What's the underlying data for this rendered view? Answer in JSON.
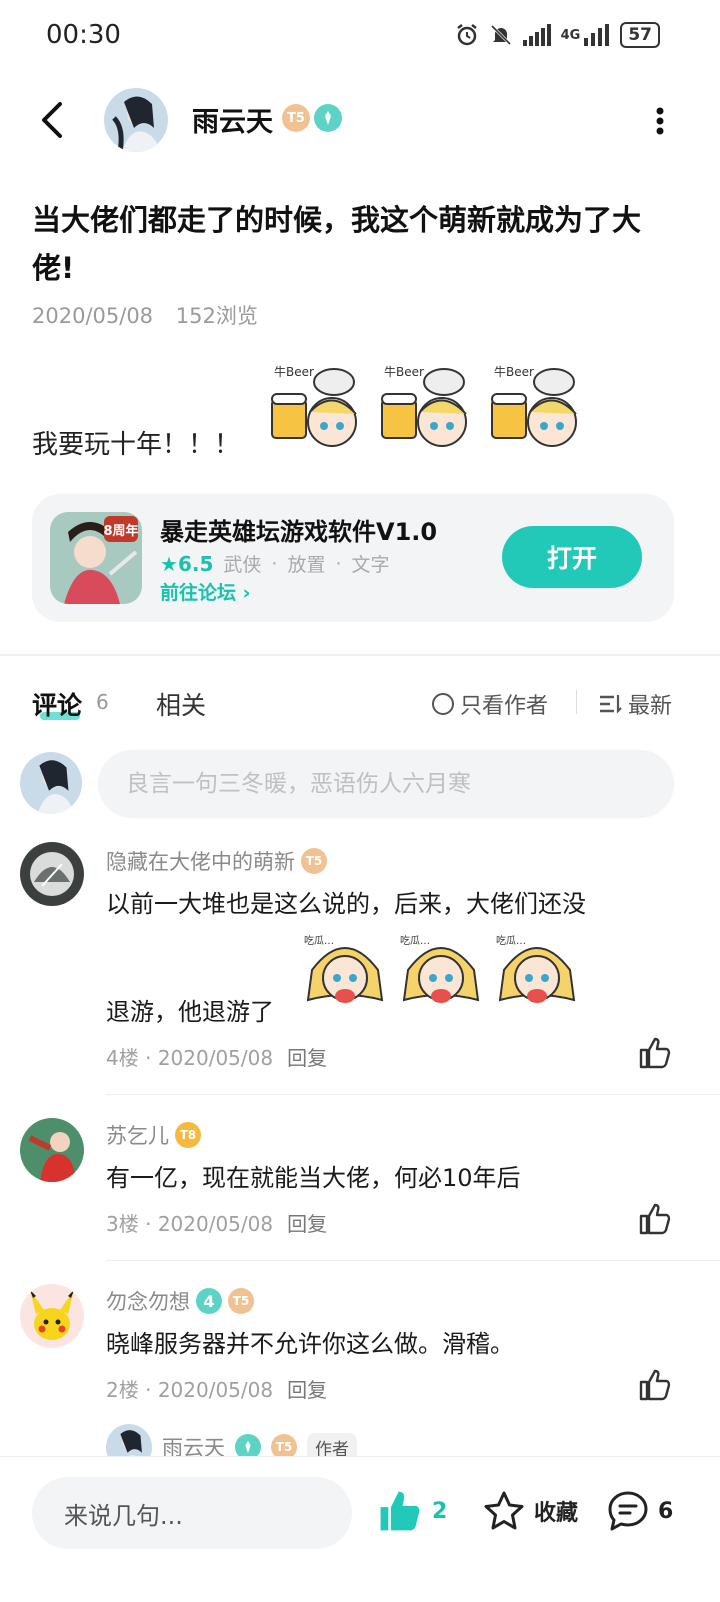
{
  "status_bar": {
    "time": "00:30",
    "network": "4G",
    "battery": "57"
  },
  "header": {
    "user_name": "雨云天",
    "badge_t": "T5"
  },
  "post": {
    "title": "当大佬们都走了的时候，我这个萌新就成为了大佬!",
    "date": "2020/05/08",
    "views": "152浏览",
    "body": "我要玩十年！！！"
  },
  "app_card": {
    "name": "暴走英雄坛游戏软件V1.0",
    "rating": "6.5",
    "tags": [
      "武侠",
      "放置",
      "文字"
    ],
    "forum_link": "前往论坛",
    "open_label": "打开",
    "icon_label": "8周年"
  },
  "tabs": {
    "comment_label": "评论",
    "comment_count": "6",
    "related_label": "相关",
    "only_author_label": "只看作者",
    "sort_label": "最新"
  },
  "comment_input": {
    "placeholder": "良言一句三冬暖，恶语伤人六月寒"
  },
  "comments": [
    {
      "name": "隐藏在大佬中的萌新",
      "badge": "T5",
      "text_line1": "以前一大堆也是这么说的，后来，大佬们还没",
      "text_line2": "退游，他退游了",
      "floor": "4楼",
      "date": "2020/05/08",
      "reply": "回复"
    },
    {
      "name": "苏乞儿",
      "badge": "T8",
      "text": "有一亿，现在就能当大佬，何必10年后",
      "floor": "3楼",
      "date": "2020/05/08",
      "reply": "回复"
    },
    {
      "name": "勿念勿想",
      "level": "4",
      "badge": "T5",
      "text": "晓峰服务器并不允许你这么做。滑稽。",
      "floor": "2楼",
      "date": "2020/05/08",
      "reply": "回复"
    }
  ],
  "sub_reply": {
    "name": "雨云天",
    "badge": "T5",
    "author_tag": "作者"
  },
  "bottom_bar": {
    "input_label": "来说几句...",
    "like_count": "2",
    "fav_label": "收藏",
    "comment_count": "6"
  },
  "colors": {
    "accent": "#22c9b8",
    "badge_t": "#f0c292",
    "badge_gold": "#f5b93d"
  }
}
